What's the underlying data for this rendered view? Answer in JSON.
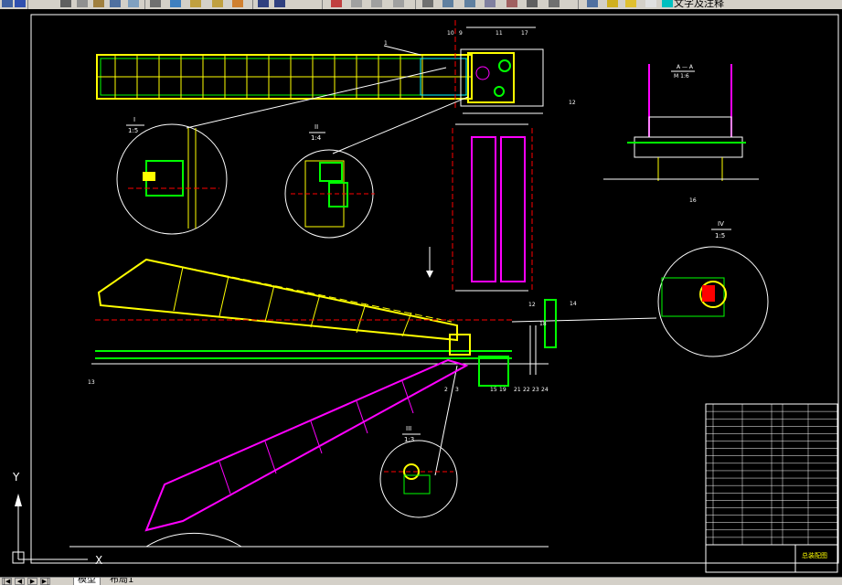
{
  "toolbar": {
    "text_style_label": "文字及注释",
    "icons": [
      "open-icon",
      "save-icon",
      "print-icon",
      "preview-icon",
      "plot-icon",
      "cut-icon",
      "copy-icon",
      "paste-icon",
      "match-icon",
      "undo-icon",
      "redo-icon",
      "pan-icon",
      "zoom-realtime-icon",
      "zoom-window-icon",
      "zoom-previous-icon",
      "properties-icon",
      "design-center-icon",
      "tool-palette-icon",
      "calculator-icon",
      "layer-icon",
      "layer-state-icon",
      "color-icon"
    ]
  },
  "drawing": {
    "section_A_title": "A — A",
    "section_A_scale": "M 1:6",
    "detail_I_title": "I",
    "detail_I_scale": "1:5",
    "detail_II_title": "II",
    "detail_II_scale": "1:4",
    "detail_III_title": "III",
    "detail_III_scale": "1:3",
    "detail_IV_title": "IV",
    "detail_IV_scale": "1:5",
    "callouts": [
      "1",
      "10",
      "9",
      "11",
      "17",
      "12",
      "12",
      "14",
      "18",
      "13",
      "2",
      "3",
      "15",
      "19",
      "21",
      "22",
      "23",
      "24",
      "16"
    ],
    "ucs_y": "Y",
    "ucs_x": "X"
  },
  "title_block": {
    "drawing_title": "总装配图",
    "rows": 19
  },
  "tabs": {
    "nav": [
      "|◀",
      "◀",
      "▶",
      "▶|"
    ],
    "model": "模型",
    "layout1": "布局1"
  },
  "colors": {
    "background": "#000000",
    "yellow": "#ffff00",
    "green": "#00ff00",
    "magenta": "#ff00ff",
    "cyan": "#00ffff",
    "white": "#ffffff",
    "red": "#ff0000"
  }
}
